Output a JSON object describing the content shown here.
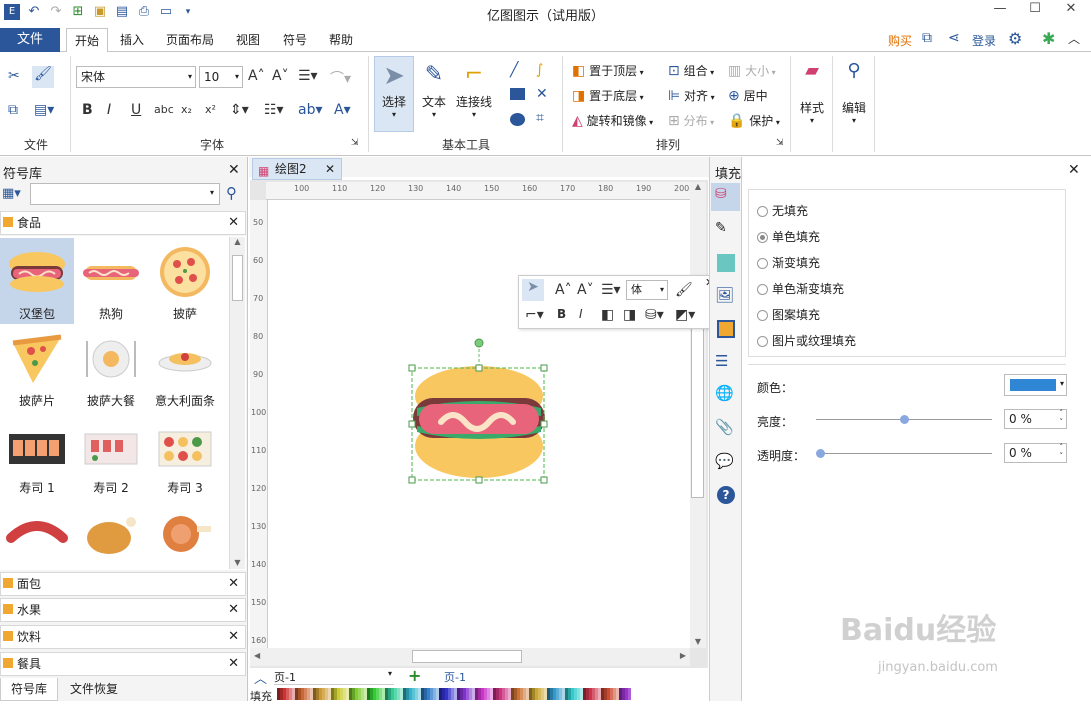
{
  "app": {
    "title": "亿图图示（试用版）"
  },
  "quick_access": [
    "logo-icon",
    "undo-icon",
    "redo-icon",
    "export-icon",
    "open-icon",
    "save-icon",
    "print-icon",
    "page-icon",
    "more-icon"
  ],
  "menu": {
    "file": "文件",
    "tabs": [
      "开始",
      "插入",
      "页面布局",
      "视图",
      "符号",
      "帮助"
    ],
    "buy": "购买",
    "login": "登录"
  },
  "ribbon": {
    "font_name": "宋体",
    "font_size": "10",
    "groups": {
      "file": "文件",
      "font": "字体",
      "tools": "基本工具",
      "arrange": "排列"
    },
    "tools": {
      "select": "选择",
      "text": "文本",
      "connector": "连接线"
    },
    "arrange": {
      "top": "置于顶层",
      "bottom": "置于底层",
      "rotate": "旋转和镜像",
      "group": "组合",
      "align": "对齐",
      "distribute": "分布",
      "size": "大小",
      "center": "居中",
      "protect": "保护"
    },
    "style": "样式",
    "edit": "编辑"
  },
  "symbols": {
    "title": "符号库",
    "search_placeholder": "",
    "food": "食品",
    "items": [
      [
        "汉堡包",
        "热狗",
        "披萨"
      ],
      [
        "披萨片",
        "披萨大餐",
        "意大利面条"
      ],
      [
        "寿司 1",
        "寿司 2",
        "寿司 3"
      ]
    ],
    "cats": [
      "面包",
      "水果",
      "饮料",
      "餐具"
    ],
    "bottom_tabs": [
      "符号库",
      "文件恢复"
    ]
  },
  "canvas": {
    "tab": "绘图2",
    "ruler_h": [
      "100",
      "110",
      "120",
      "130",
      "140",
      "150",
      "160",
      "170",
      "180",
      "190",
      "200"
    ],
    "ruler_v": [
      "50",
      "60",
      "70",
      "80",
      "90",
      "100",
      "110",
      "120",
      "130",
      "140",
      "150",
      "160"
    ],
    "mini_font": "体"
  },
  "pages": {
    "page_select": "页-1",
    "page_tab": "页-1",
    "fill_label": "填充"
  },
  "fill": {
    "title": "填充",
    "options": [
      "无填充",
      "单色填充",
      "渐变填充",
      "单色渐变填充",
      "图案填充",
      "图片或纹理填充"
    ],
    "color_label": "颜色：",
    "brightness_label": "亮度：",
    "brightness_value": "0 %",
    "brightness_level": 0.5,
    "transparency_label": "透明度：",
    "transparency_value": "0 %",
    "transparency_level": 0,
    "accent": "#2f86d4"
  },
  "watermark": {
    "text": "Baidu经验",
    "url": "jingyan.baidu.com"
  }
}
